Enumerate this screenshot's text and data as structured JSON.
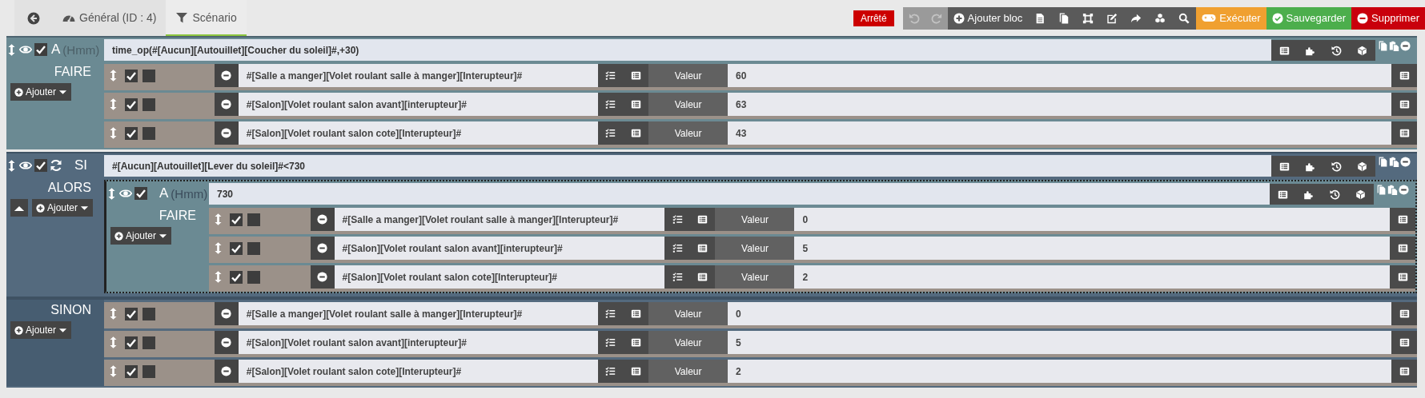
{
  "tabs": [
    {
      "label": "Général (ID : 4)",
      "selected": false
    },
    {
      "label": "Scénario",
      "selected": true
    }
  ],
  "status_badge": "Arrêté",
  "history_buttons": [
    {
      "kind": "undo",
      "disabled": true
    },
    {
      "kind": "redo",
      "disabled": true
    }
  ],
  "add_block_label": "Ajouter bloc",
  "action_buttons": [
    {
      "kind": "run",
      "label": "Exécuter"
    },
    {
      "kind": "save",
      "label": "Sauvegarder"
    },
    {
      "kind": "delete",
      "label": "Supprimer"
    }
  ],
  "blocks": [
    {
      "kind": "at",
      "checked": true,
      "label": "A",
      "hint": "(Hmm)",
      "condition": "time_op(#[Aucun][Autouillet][Coucher du soleil]#,+30)",
      "section_label": "FAIRE",
      "add_label": "Ajouter",
      "actions": [
        {
          "checked": true,
          "second_checked": false,
          "command": "#[Salle a manger][Volet roulant salle à manger][Interupteur]#",
          "value_label": "Valeur",
          "value": "60"
        },
        {
          "checked": true,
          "second_checked": false,
          "command": "#[Salon][Volet roulant salon avant][interupteur]#",
          "value_label": "Valeur",
          "value": "63"
        },
        {
          "checked": true,
          "second_checked": false,
          "command": "#[Salon][Volet roulant salon cote][Interupteur]#",
          "value_label": "Valeur",
          "value": "43"
        }
      ]
    },
    {
      "kind": "if",
      "checked": true,
      "label": "SI",
      "condition": "#[Aucun][Autouillet][Lever du soleil]#<730",
      "then": {
        "label": "ALORS",
        "add_label": "Ajouter",
        "blocks": [
          {
            "kind": "at",
            "checked": true,
            "label": "A",
            "hint": "(Hmm)",
            "condition": "730",
            "section_label": "FAIRE",
            "add_label": "Ajouter",
            "actions": [
              {
                "checked": true,
                "second_checked": false,
                "command": "#[Salle a manger][Volet roulant salle à manger][Interupteur]#",
                "value_label": "Valeur",
                "value": "0"
              },
              {
                "checked": true,
                "second_checked": false,
                "command": "#[Salon][Volet roulant salon avant][interupteur]#",
                "value_label": "Valeur",
                "value": "5"
              },
              {
                "checked": true,
                "second_checked": false,
                "command": "#[Salon][Volet roulant salon cote][Interupteur]#",
                "value_label": "Valeur",
                "value": "2"
              }
            ]
          }
        ]
      },
      "else": {
        "label": "SINON",
        "add_label": "Ajouter",
        "actions": [
          {
            "checked": true,
            "second_checked": false,
            "command": "#[Salle a manger][Volet roulant salle à manger][Interupteur]#",
            "value_label": "Valeur",
            "value": "0"
          },
          {
            "checked": true,
            "second_checked": false,
            "command": "#[Salon][Volet roulant salon avant][interupteur]#",
            "value_label": "Valeur",
            "value": "5"
          },
          {
            "checked": true,
            "second_checked": false,
            "command": "#[Salon][Volet roulant salon cote][Interupteur]#",
            "value_label": "Valeur",
            "value": "2"
          }
        ]
      }
    }
  ]
}
